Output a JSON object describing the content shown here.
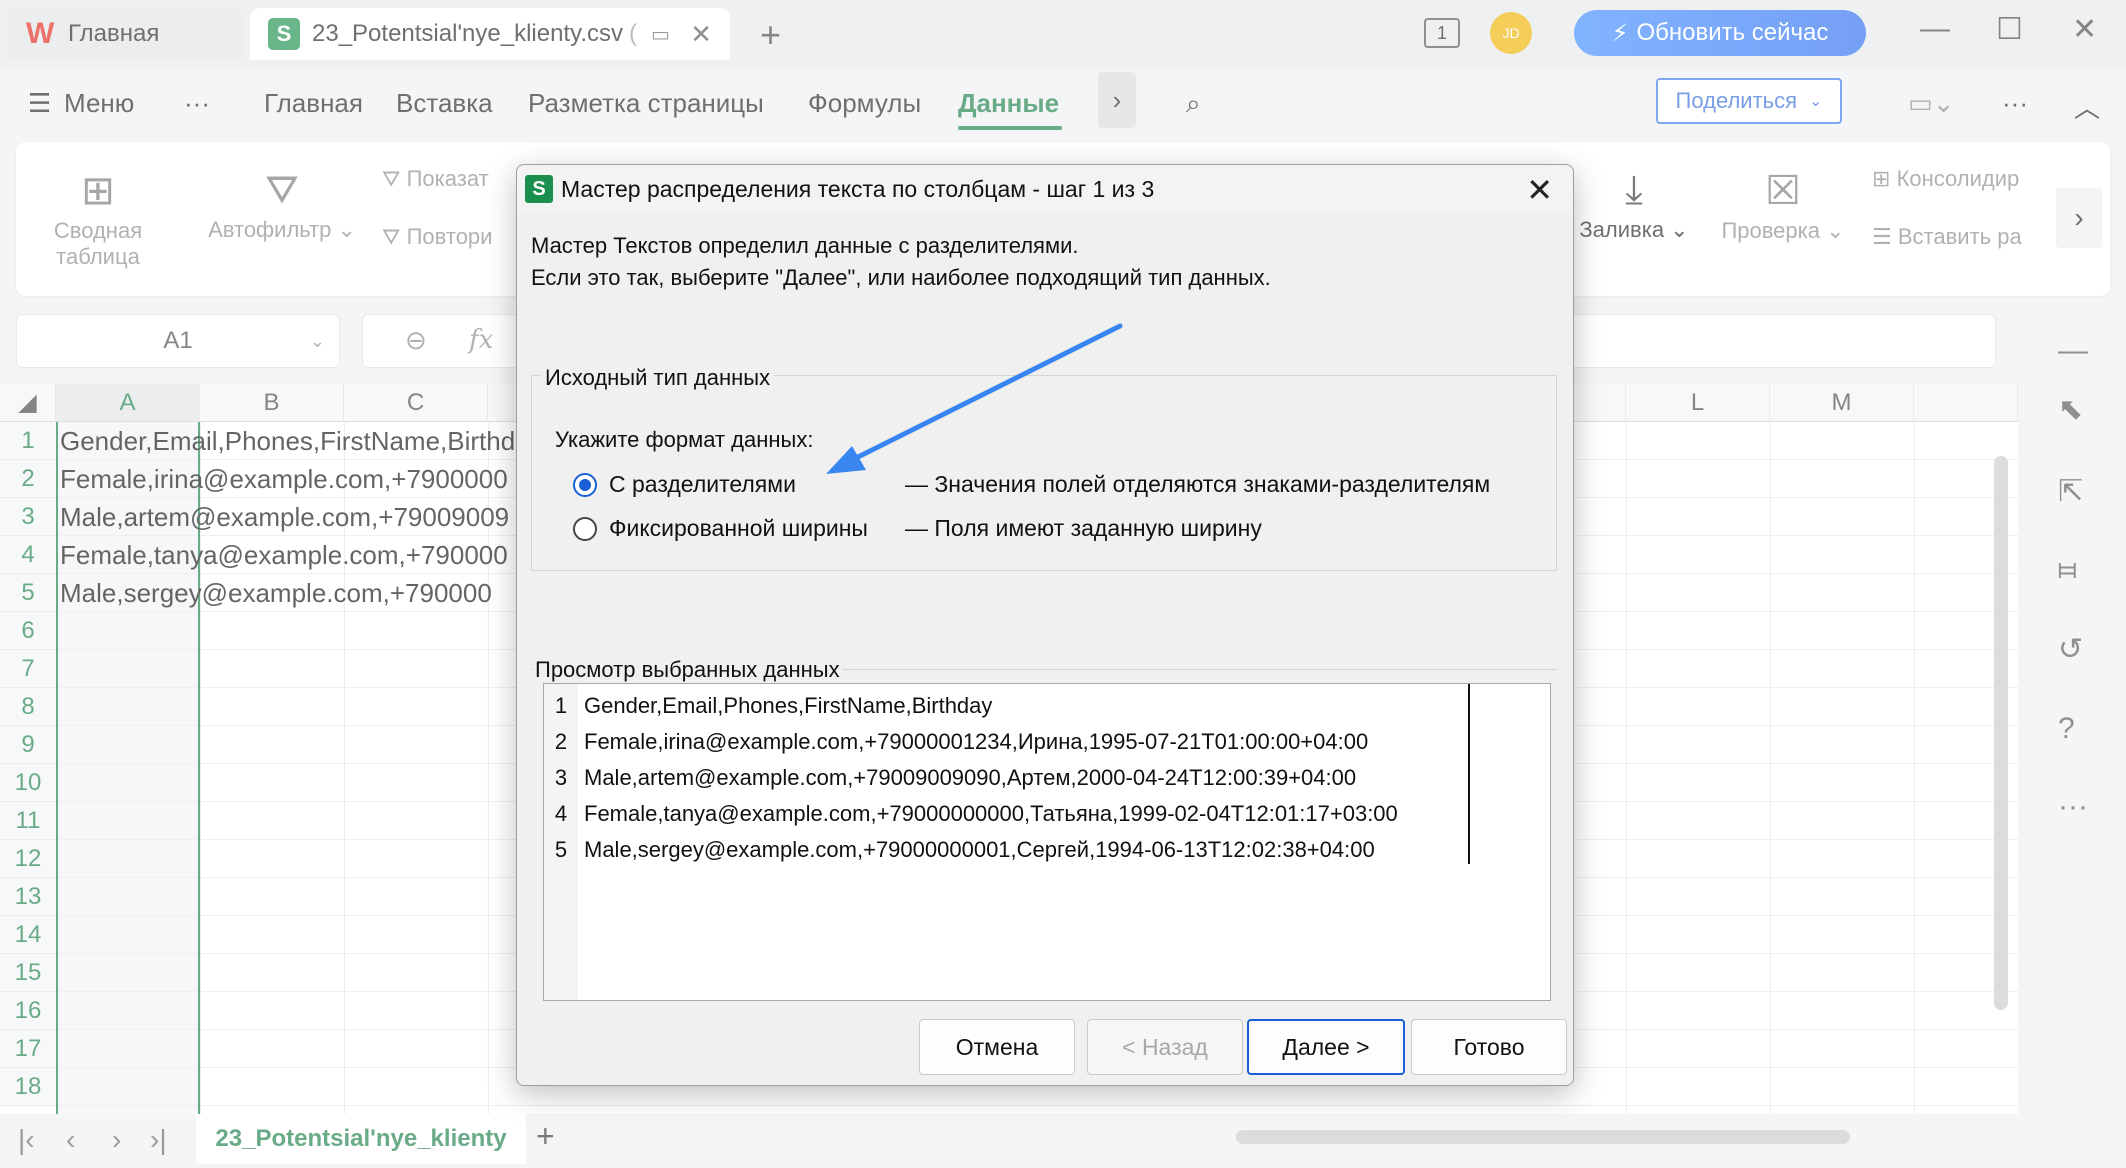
{
  "titlebar": {
    "home_tab": "Главная",
    "file_tab": "23_Potentsial'nye_klienty.csv",
    "file_tab_suffix": "(",
    "badge_count": "1",
    "avatar_initials": "JD",
    "update_button": "Обновить сейчас"
  },
  "menubar": {
    "menu": "Меню",
    "more": "···",
    "items": [
      "Главная",
      "Вставка",
      "Разметка страницы",
      "Формулы",
      "Данные"
    ],
    "share": "Поделиться"
  },
  "ribbon": {
    "pivot": [
      "Сводная",
      "таблица"
    ],
    "autofilter": "Автофильтр",
    "show": "Показат",
    "repeat": "Повтори",
    "fill": "Заливка",
    "validate": "Проверка",
    "consolidate": "Консолидир",
    "insert": "Вставить ра"
  },
  "formula": {
    "namebox": "A1",
    "fx": "fx"
  },
  "grid": {
    "columns": [
      "A",
      "B",
      "C",
      "L",
      "M"
    ],
    "rows": [
      "1",
      "2",
      "3",
      "4",
      "5",
      "6",
      "7",
      "8",
      "9",
      "10",
      "11",
      "12",
      "13",
      "14",
      "15",
      "16",
      "17",
      "18"
    ],
    "cells": [
      "Gender,Email,Phones,FirstName,Birthd",
      "Female,irina@example.com,+7900000",
      "Male,artem@example.com,+79009009",
      "Female,tanya@example.com,+790000",
      "Male,sergey@example.com,+790000"
    ]
  },
  "sheet": {
    "tab": "23_Potentsial'nye_klienty",
    "add": "+"
  },
  "dialog": {
    "title": "Мастер распределения текста по столбцам - шаг 1 из 3",
    "line1": "Мастер Текстов определил данные с разделителями.",
    "line2": "Если это так, выберите \"Далее\", или наиболее подходящий тип данных.",
    "group_label": "Исходный тип данных",
    "format_prompt": "Укажите формат данных:",
    "option_delimited": "С разделителями",
    "option_delimited_desc": "— Значения полей отделяются знаками-разделителям",
    "option_fixed": "Фиксированной ширины",
    "option_fixed_desc": "— Поля имеют заданную ширину",
    "preview_label": "Просмотр выбранных данных",
    "preview_rows": [
      {
        "n": "1",
        "text": "Gender,Email,Phones,FirstName,Birthday"
      },
      {
        "n": "2",
        "text": "Female,irina@example.com,+79000001234,Ирина,1995-07-21T01:00:00+04:00"
      },
      {
        "n": "3",
        "text": "Male,artem@example.com,+79009009090,Артем,2000-04-24T12:00:39+04:00"
      },
      {
        "n": "4",
        "text": "Female,tanya@example.com,+79000000000,Татьяна,1999-02-04T12:01:17+03:00"
      },
      {
        "n": "5",
        "text": "Male,sergey@example.com,+79000000001,Сергей,1994-06-13T12:02:38+04:00"
      }
    ],
    "btn_cancel": "Отмена",
    "btn_back": "< Назад",
    "btn_next": "Далее >",
    "btn_finish": "Готово"
  },
  "colors": {
    "accent_green": "#1a7f48",
    "accent_blue": "#1a5fd6",
    "annotation_arrow": "#3a86f0"
  }
}
